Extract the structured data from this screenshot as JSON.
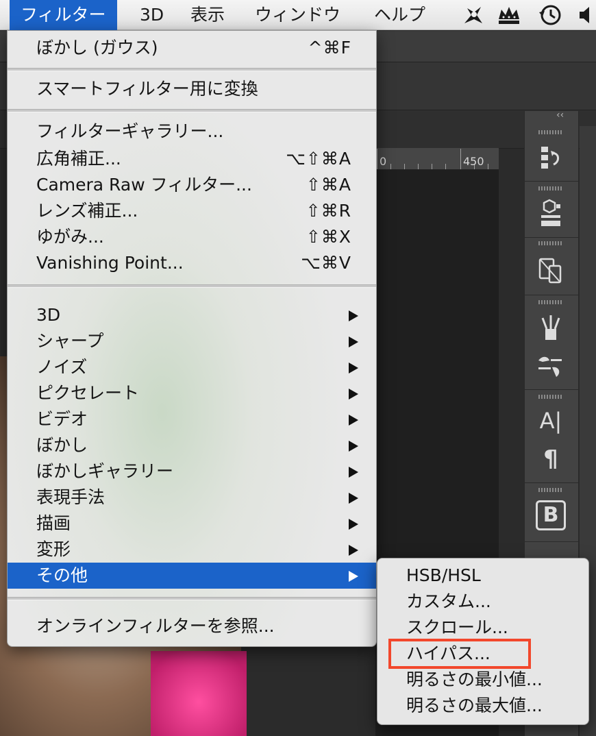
{
  "menubar": {
    "items": [
      "フィルター",
      "3D",
      "表示",
      "ウィンドウ",
      "ヘルプ"
    ],
    "active_index": 0,
    "status_icons": [
      "script-icon",
      "crown-icon",
      "time-machine-icon",
      "volume-icon"
    ]
  },
  "ruler": {
    "labels": [
      "0",
      "450"
    ]
  },
  "filter_menu": {
    "items": [
      {
        "label": "ぼかし (ガウス)",
        "shortcut": "^⌘F"
      },
      {
        "label": "スマートフィルター用に変換",
        "shortcut": ""
      },
      {
        "label": "フィルターギャラリー...",
        "shortcut": ""
      },
      {
        "label": "広角補正...",
        "shortcut": "⌥⇧⌘A"
      },
      {
        "label": "Camera Raw フィルター...",
        "shortcut": "⇧⌘A"
      },
      {
        "label": "レンズ補正...",
        "shortcut": "⇧⌘R"
      },
      {
        "label": "ゆがみ...",
        "shortcut": "⇧⌘X"
      },
      {
        "label": "Vanishing Point...",
        "shortcut": "⌥⌘V"
      },
      {
        "label": "3D",
        "submenu": true
      },
      {
        "label": "シャープ",
        "submenu": true
      },
      {
        "label": "ノイズ",
        "submenu": true
      },
      {
        "label": "ピクセレート",
        "submenu": true
      },
      {
        "label": "ビデオ",
        "submenu": true
      },
      {
        "label": "ぼかし",
        "submenu": true
      },
      {
        "label": "ぼかしギャラリー",
        "submenu": true
      },
      {
        "label": "表現手法",
        "submenu": true
      },
      {
        "label": "描画",
        "submenu": true
      },
      {
        "label": "変形",
        "submenu": true
      },
      {
        "label": "その他",
        "submenu": true,
        "active": true
      },
      {
        "label": "オンラインフィルターを参照...",
        "shortcut": ""
      }
    ]
  },
  "other_submenu": {
    "items": [
      "HSB/HSL",
      "カスタム...",
      "スクロール...",
      "ハイパス...",
      "明るさの最小値...",
      "明るさの最大値..."
    ],
    "highlighted_index": 3,
    "highlight_color": "#f2472c"
  },
  "toolstrip": {
    "icons": [
      "history-icon",
      "3d-icon",
      "device-preview-icon",
      "brushes-icon",
      "brush-settings-icon",
      "character-icon",
      "paragraph-icon",
      "glyphs-icon"
    ],
    "character_glyph": "A|",
    "paragraph_glyph": "¶",
    "glyphs_letter": "B",
    "collapse_glyph": "‹‹"
  },
  "colors": {
    "menu_highlight": "#1b63c9",
    "menu_bg": "#e8e8e8",
    "app_bg": "#2b2b2b"
  }
}
